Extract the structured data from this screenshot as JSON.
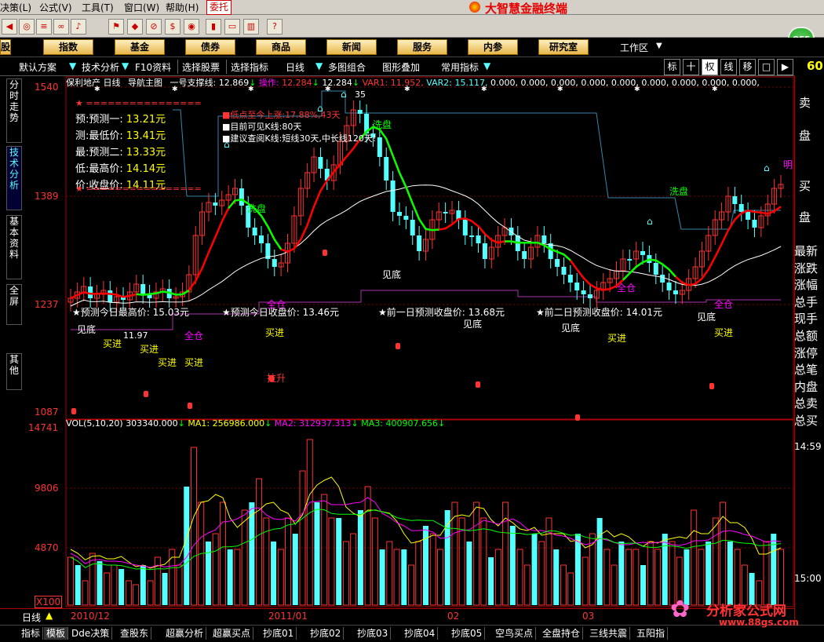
{
  "menubar": {
    "items": [
      "决策(L)",
      "公式(V)",
      "工具(T)",
      "窗口(W)",
      "帮助(H)"
    ],
    "weituo": "委托",
    "brand": "大智慧金融终端"
  },
  "navbuttons": [
    "股",
    "指数",
    "基金",
    "债券",
    "商品",
    "新闻",
    "服务",
    "内参",
    "研究室"
  ],
  "workspace_label": "工作区",
  "off_label": "OFF",
  "toolbar2": {
    "items": [
      "默认方案",
      "技术分析",
      "F10资料",
      "选择股票",
      "选择指标",
      "日线",
      "多图组合",
      "图形叠加",
      "常用指标"
    ],
    "buttons": [
      "标",
      "十",
      "权",
      "线",
      "移",
      "□",
      "▶"
    ],
    "right_num": "60"
  },
  "left_tabs": [
    "分时走势",
    "技术分析",
    "基本资料",
    "全屏",
    "其他"
  ],
  "info_line": {
    "stock": "保利地产",
    "period": "日线",
    "main_chart": "导航主图",
    "support_label": "一号支撑线:",
    "support_val": "12.869",
    "op_label": "操作:",
    "op_val1": "12.284",
    "op_val2": "12.284",
    "var1": "VAR1: 11.952,",
    "var2": "VAR2: 15.117,",
    "zeros": "0.000, 0.000, 0.000, 0.000, 0.000, 0.000, 0.000, 0.000, 0.000,"
  },
  "prediction_box": {
    "star_line": "★ ================",
    "rows": [
      {
        "label": "预:预测一:",
        "value": "13.21元"
      },
      {
        "label": "测:最低价:",
        "value": "13.41元"
      },
      {
        "label": "最:预测二:",
        "value": "13.33元"
      },
      {
        "label": "低:最高价:",
        "value": "14.14元"
      },
      {
        "label": "价:收盘价:",
        "value": "14.11元"
      }
    ]
  },
  "notes": [
    "低点至今上涨:17.88%,43天",
    "目前可见K线:80天",
    "建议查阅K线:短线30天,中长线120天!"
  ],
  "bottom_labels": [
    "★预测今日最高价: 15.03元",
    "★预测今日收盘价: 13.46元",
    "★前一日预测收盘价: 13.68元",
    "★前二日预测收盘价: 14.01元"
  ],
  "annotations": {
    "price_35": "35",
    "xipan": "洗盘",
    "jiandi": "见底",
    "mairu": "买进",
    "quancang": "全仓",
    "lasheng": "拉升",
    "ming": "明",
    "low_val": "11.97"
  },
  "price_axis": [
    "1540",
    "1389",
    "1237",
    "1087"
  ],
  "vol_axis": [
    "14741",
    "9806",
    "4870",
    "X100"
  ],
  "vol_line": {
    "label": "VOL(5,10,20)",
    "vol": "303340.000",
    "ma1": "MA1: 256986.000",
    "ma2": "MA2: 312937.313",
    "ma3": "MA3: 400907.656"
  },
  "date_axis": [
    "2010/12",
    "2011/01",
    "02",
    "03"
  ],
  "period_label": "日线",
  "right_panel": {
    "top": [
      "卖",
      "盘",
      "买",
      "盘"
    ],
    "list": [
      "最新",
      "涨跌",
      "涨幅",
      "总手",
      "现手",
      "总额",
      "涨停",
      "总笔",
      "内盘",
      "总卖",
      "总买"
    ],
    "time": "14:59",
    "time2": "15:00"
  },
  "bottom_tabs": [
    "指标",
    "模板",
    "Dde决策",
    "查股东",
    "超赢分析",
    "超赢买点",
    "抄底01",
    "抄底02",
    "抄底03",
    "抄底04",
    "抄底05",
    "空鸟买点",
    "全盘持仓",
    "三线共震",
    "五阳指"
  ],
  "watermark": {
    "name": "分析家公式网",
    "url": "www.88gs.com"
  },
  "colors": {
    "up": "#ff3333",
    "down": "#54ffff",
    "ma_white": "#ffffff",
    "ma_red": "#ff0000",
    "ma_green": "#00ff00",
    "accent": "#ffff00"
  }
}
